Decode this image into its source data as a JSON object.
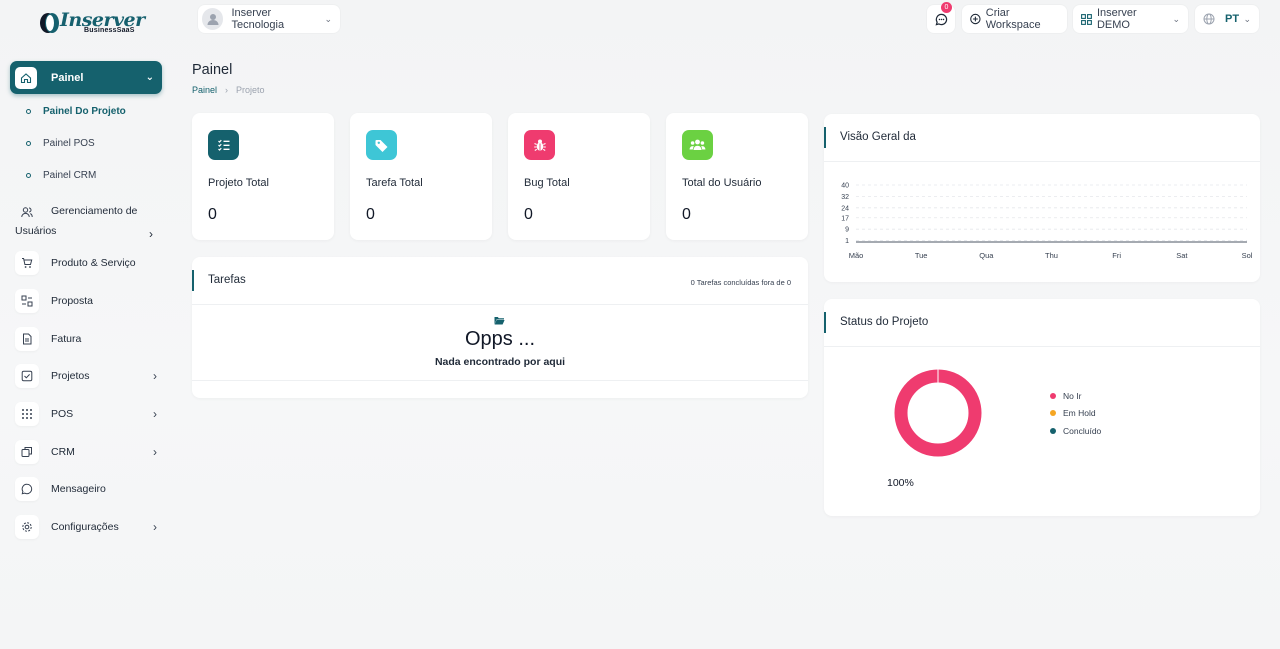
{
  "brand": {
    "logo_word": "Inserver",
    "logo_sub": "BusinessSaaS"
  },
  "topbar": {
    "workspace": "Inserver Tecnologia",
    "messages_badge": "0",
    "create_workspace": "Criar Workspace",
    "company": "Inserver DEMO",
    "language": "PT"
  },
  "sidebar": {
    "active": "Painel",
    "sub_items": [
      "Painel Do Projeto",
      "Painel POS",
      "Painel CRM"
    ],
    "users_line1": "Gerenciamento de",
    "users_line2": "Usuários",
    "items": [
      "Produto & Serviço",
      "Proposta",
      "Fatura",
      "Projetos",
      "POS",
      "CRM",
      "Mensageiro",
      "Configurações"
    ]
  },
  "page": {
    "title": "Painel",
    "breadcrumb": [
      "Painel",
      "Projeto"
    ]
  },
  "stats": [
    {
      "label": "Projeto Total",
      "value": "0",
      "color": "#15616d",
      "icon": "list-check-icon"
    },
    {
      "label": "Tarefa Total",
      "value": "0",
      "color": "#3ec6d6",
      "icon": "tag-icon"
    },
    {
      "label": "Bug Total",
      "value": "0",
      "color": "#ef3b6f",
      "icon": "bug-icon"
    },
    {
      "label": "Total do Usuário",
      "value": "0",
      "color": "#6bd142",
      "icon": "users-icon"
    }
  ],
  "tasks": {
    "title": "Tarefas",
    "note": "0 Tarefas concluídas fora de 0",
    "empty_title": "Opps ...",
    "empty_text": "Nada encontrado por aqui"
  },
  "overview": {
    "title": "Visão Geral da"
  },
  "status": {
    "title": "Status do Projeto",
    "percent": "100%"
  },
  "chart_data": [
    {
      "type": "line",
      "categories": [
        "Mão",
        "Tue",
        "Qua",
        "Thu",
        "Fri",
        "Sat",
        "Sol"
      ],
      "series": [
        {
          "values": [
            0,
            0,
            0,
            0,
            0,
            0,
            0
          ]
        }
      ],
      "yticks": [
        1,
        9,
        17,
        24,
        32,
        40
      ],
      "ylim": [
        0,
        40
      ],
      "grid": true,
      "color": "#4b5563"
    },
    {
      "type": "pie",
      "labels": [
        "No Ir",
        "Em Hold",
        "Concluído"
      ],
      "values": [
        100,
        0,
        0
      ],
      "colors": [
        "#ef3b6f",
        "#f5a623",
        "#15616d"
      ],
      "legend": "right"
    }
  ]
}
